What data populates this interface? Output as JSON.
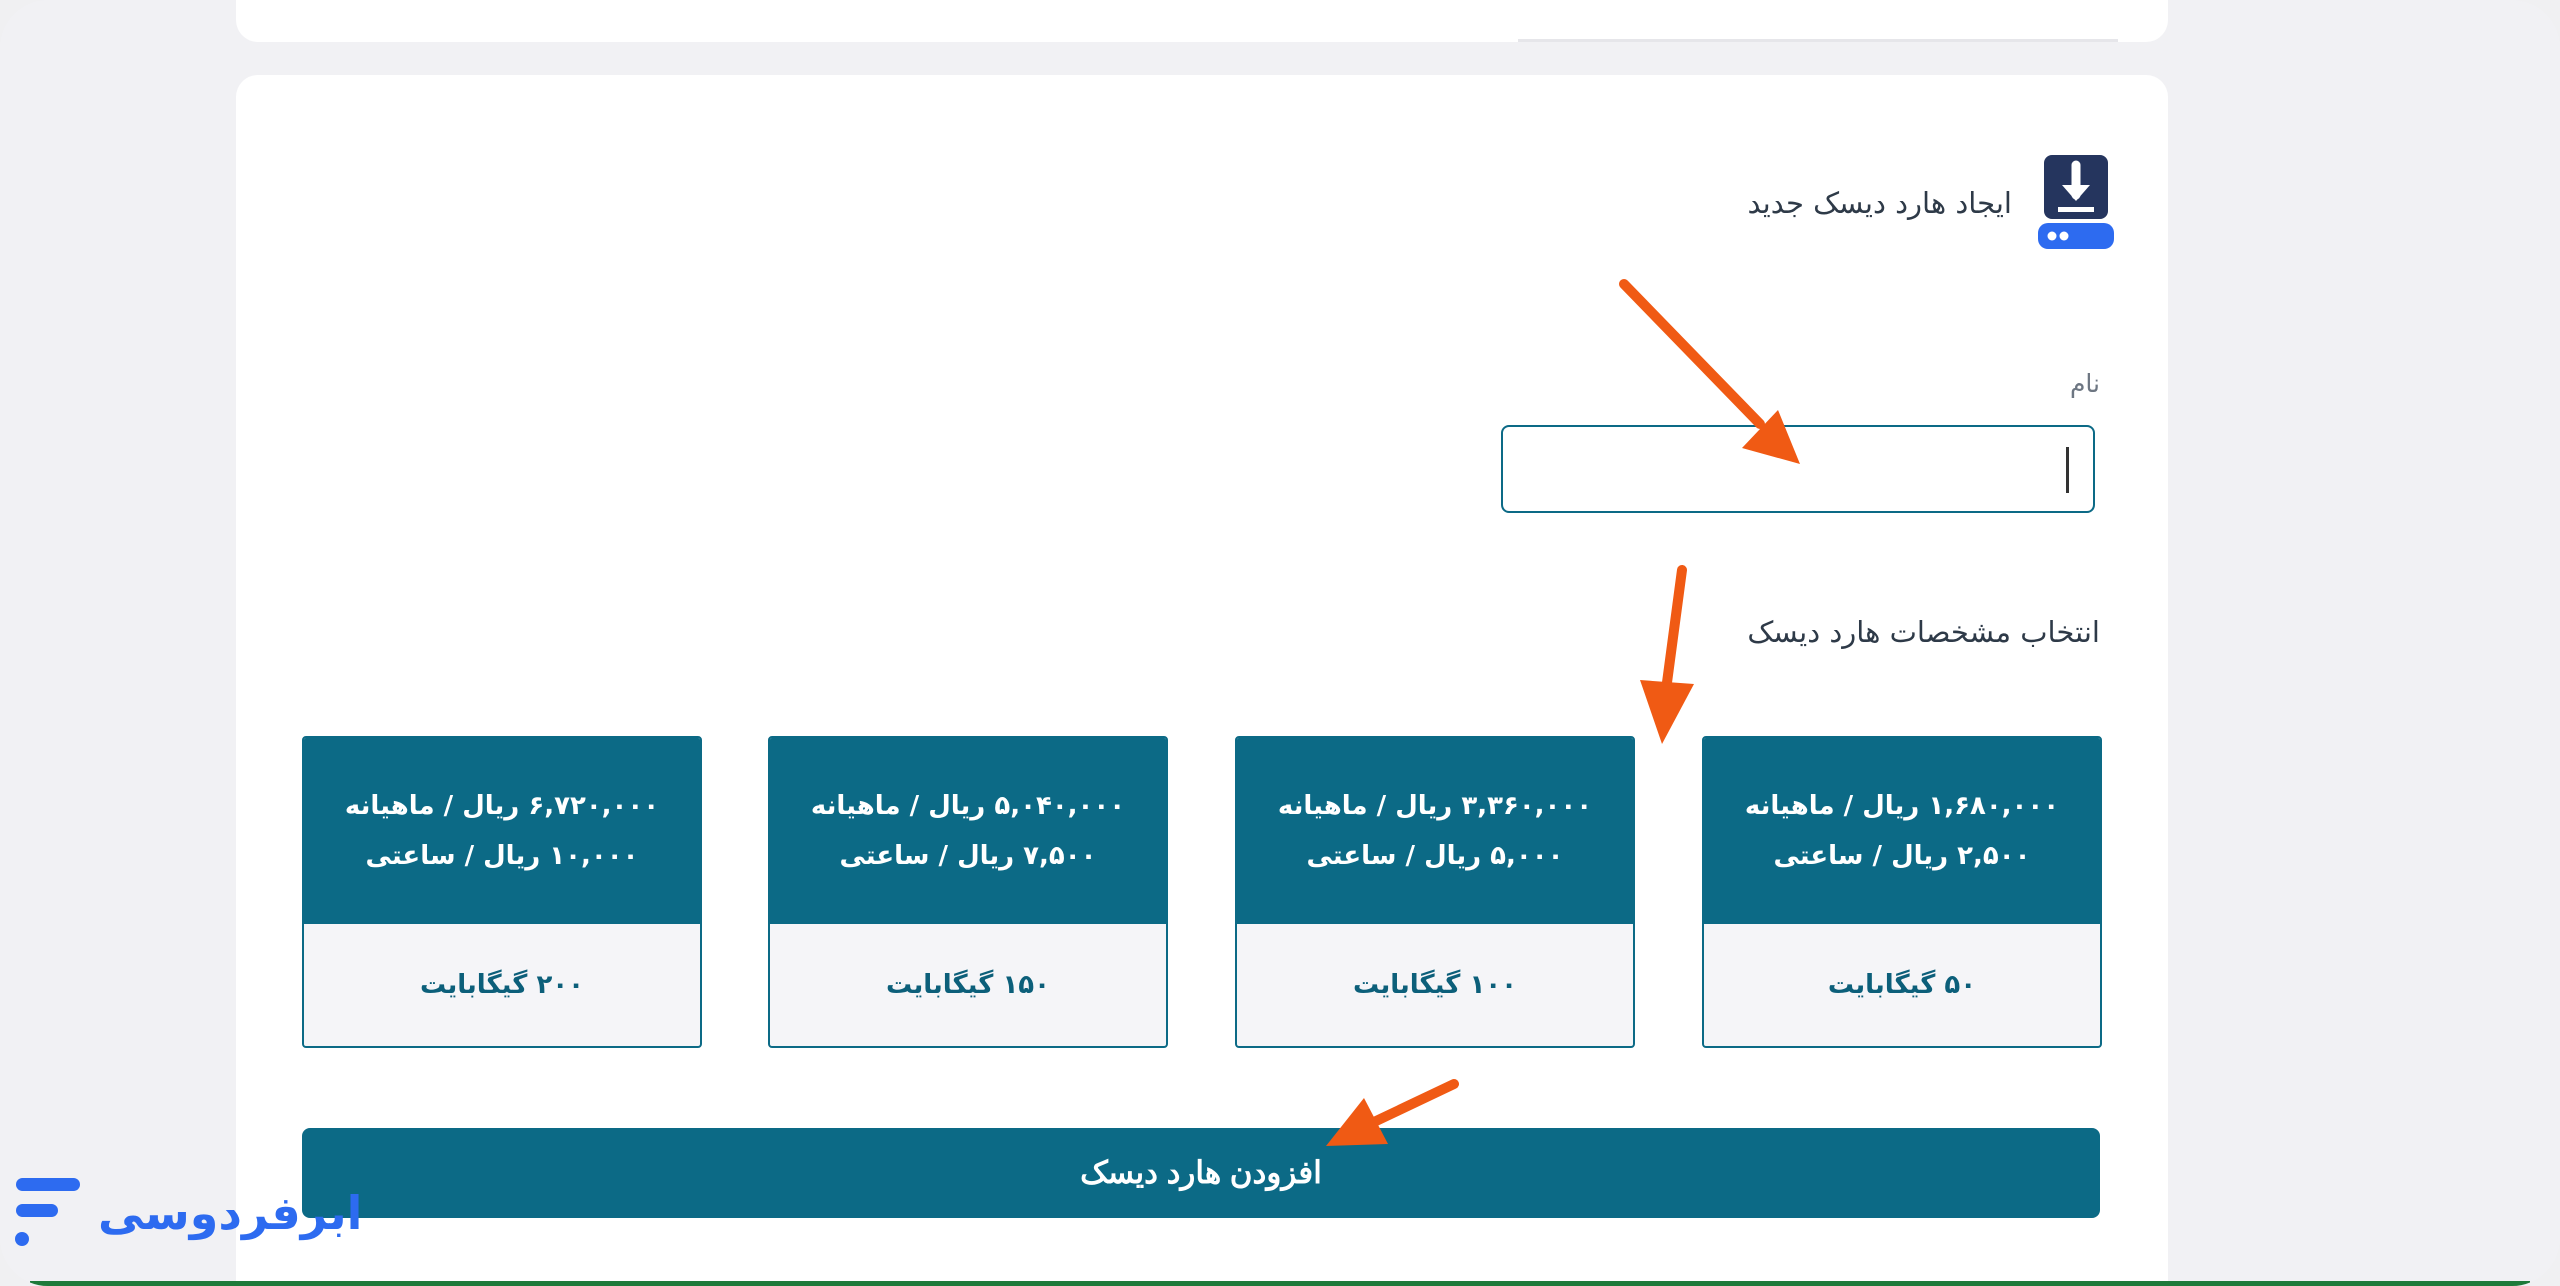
{
  "header": {
    "title": "ایجاد هارد دیسک جدید",
    "icon": "disk-download-icon"
  },
  "form": {
    "name_label": "نام",
    "name_value": "",
    "spec_label": "انتخاب مشخصات هارد دیسک"
  },
  "plans": [
    {
      "monthly": "۶,۷۲۰,۰۰۰ ریال / ماهیانه",
      "hourly": "۱۰,۰۰۰ ریال / ساعتی",
      "size": "۲۰۰ گیگابایت"
    },
    {
      "monthly": "۵,۰۴۰,۰۰۰ ریال / ماهیانه",
      "hourly": "۷,۵۰۰ ریال / ساعتی",
      "size": "۱۵۰ گیگابایت"
    },
    {
      "monthly": "۳,۳۶۰,۰۰۰ ریال / ماهیانه",
      "hourly": "۵,۰۰۰ ریال / ساعتی",
      "size": "۱۰۰ گیگابایت"
    },
    {
      "monthly": "۱,۶۸۰,۰۰۰ ریال / ماهیانه",
      "hourly": "۲,۵۰۰ ریال / ساعتی",
      "size": "۵۰ گیگابایت"
    }
  ],
  "actions": {
    "add_label": "افزودن هارد دیسک"
  },
  "brand": {
    "name": "ابرفردوسی"
  },
  "colors": {
    "primary": "#0c6a86",
    "arrow": "#f05a14",
    "brand": "#2d6bf0"
  }
}
